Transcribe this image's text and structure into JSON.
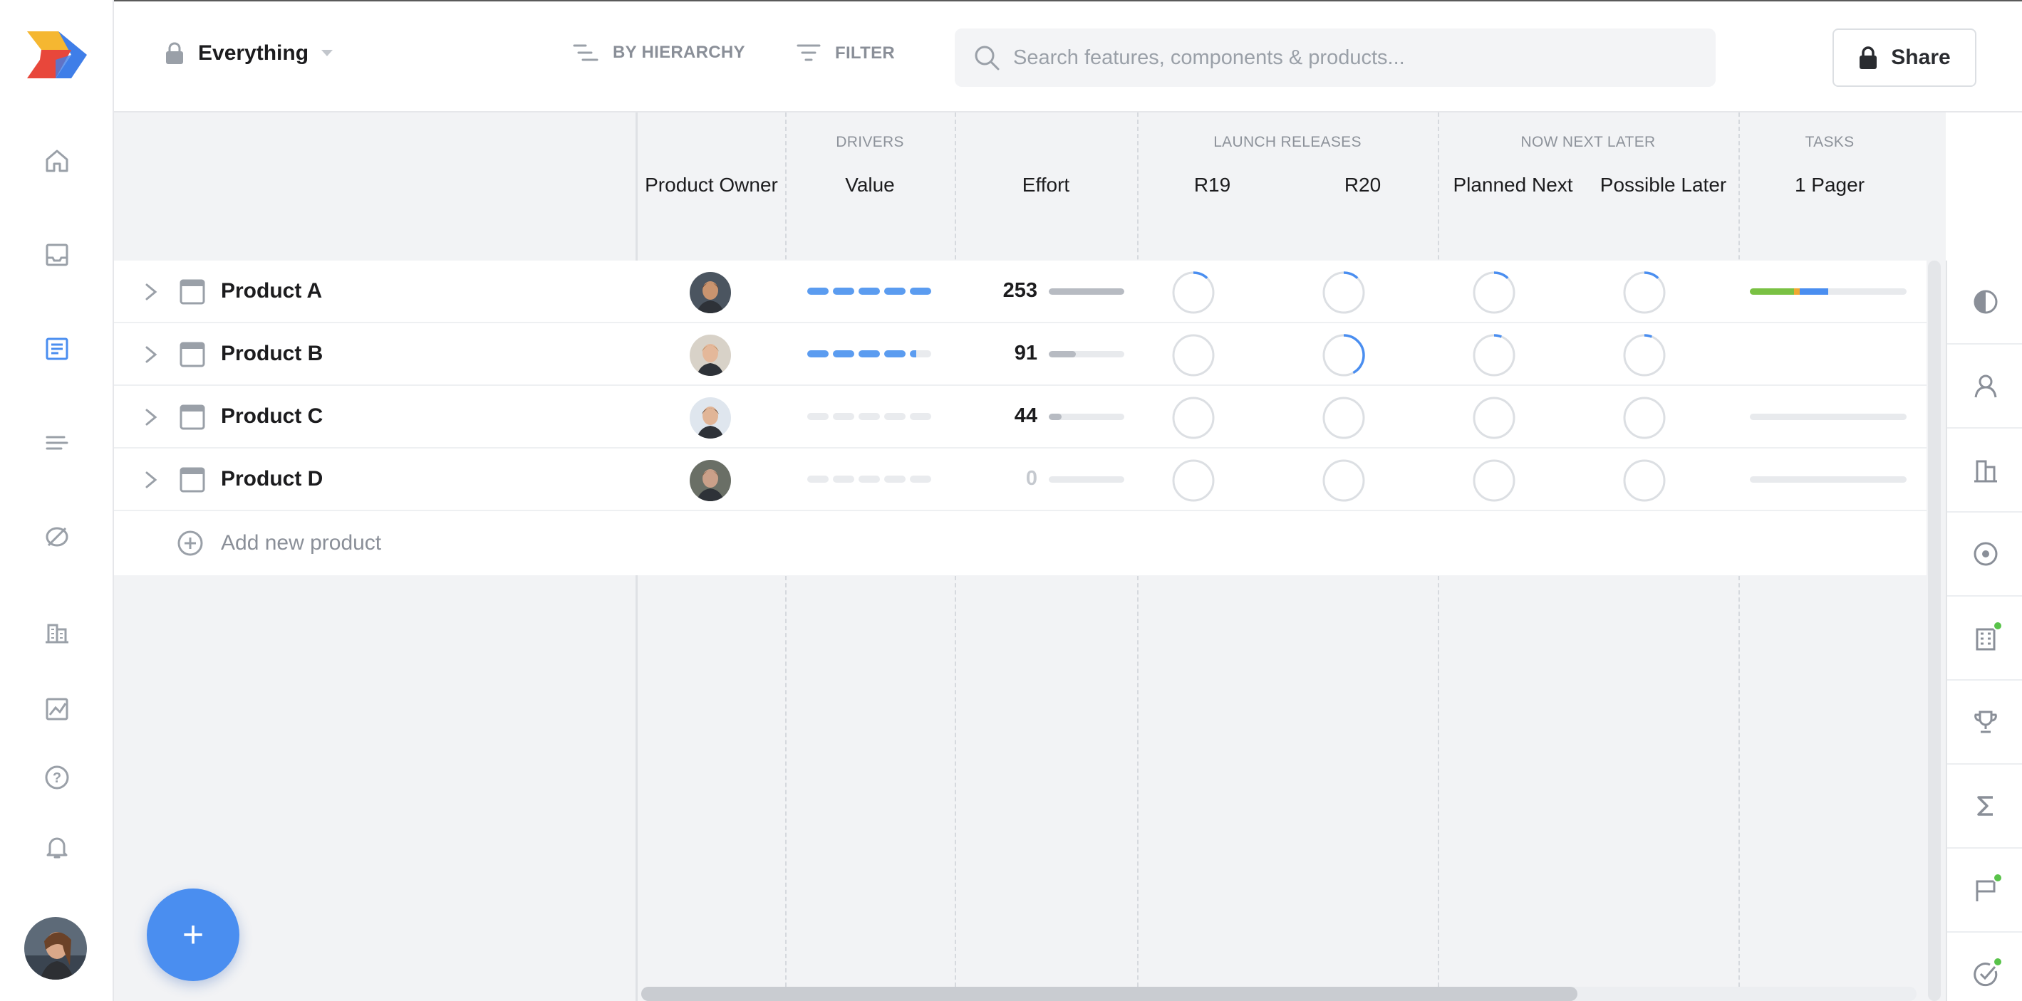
{
  "app": {
    "scope_label": "Everything",
    "hierarchy_label": "BY HIERARCHY",
    "filter_label": "FILTER",
    "search_placeholder": "Search features, components & products...",
    "share_label": "Share"
  },
  "colors": {
    "accent": "#4a8ef0",
    "value_on": "#5b9cf0",
    "ring_progress": "#4a8ef0"
  },
  "nav": [
    "home-icon",
    "inbox-icon",
    "document-icon",
    "roadmap-icon",
    "insights-icon",
    "portal-icon",
    "reports-icon",
    "help-icon",
    "notifications-icon"
  ],
  "groups": {
    "drivers": "DRIVERS",
    "launch": "LAUNCH RELEASES",
    "nnl": "NOW NEXT LATER",
    "tasks": "TASKS"
  },
  "columns": {
    "owner": "Product Owner",
    "value": "Value",
    "effort": "Effort",
    "r19": "R19",
    "r20": "R20",
    "planned_next": "Planned Next",
    "possible_later": "Possible Later",
    "one_pager": "1 Pager"
  },
  "rows": [
    {
      "name": "Product A",
      "value_segments": 5,
      "value_partial": 0,
      "effort": "253",
      "effort_fraction": 1.0,
      "r19": 0.12,
      "r20": 0.12,
      "planned_next": 0.12,
      "possible_later": 0.12,
      "pager": [
        {
          "color": "#7ac143",
          "pct": 0.28
        },
        {
          "color": "#f0a830",
          "pct": 0.04
        },
        {
          "color": "#4a8ef0",
          "pct": 0.18
        }
      ]
    },
    {
      "name": "Product B",
      "value_segments": 4,
      "value_partial": 1,
      "effort": "91",
      "effort_fraction": 0.36,
      "r19": 0,
      "r20": 0.42,
      "planned_next": 0.06,
      "possible_later": 0.06,
      "pager": []
    },
    {
      "name": "Product C",
      "value_segments": 0,
      "value_partial": 0,
      "effort": "44",
      "effort_fraction": 0.17,
      "r19": 0,
      "r20": 0,
      "planned_next": 0,
      "possible_later": 0,
      "pager": [
        {
          "color": "#e8eaed",
          "pct": 0
        }
      ]
    },
    {
      "name": "Product D",
      "value_segments": 0,
      "value_partial": 0,
      "effort": "0",
      "effort_fraction": 0,
      "r19": 0,
      "r20": 0,
      "planned_next": 0,
      "possible_later": 0,
      "pager": [
        {
          "color": "#e8eaed",
          "pct": 0
        }
      ]
    }
  ],
  "add_new_label": "Add new product",
  "right_panel": [
    "pie-icon",
    "user-icon",
    "building-icon",
    "target-icon",
    "building-alt-icon",
    "trophy-icon",
    "sigma-icon",
    "flag-icon",
    "check-circle-icon"
  ]
}
